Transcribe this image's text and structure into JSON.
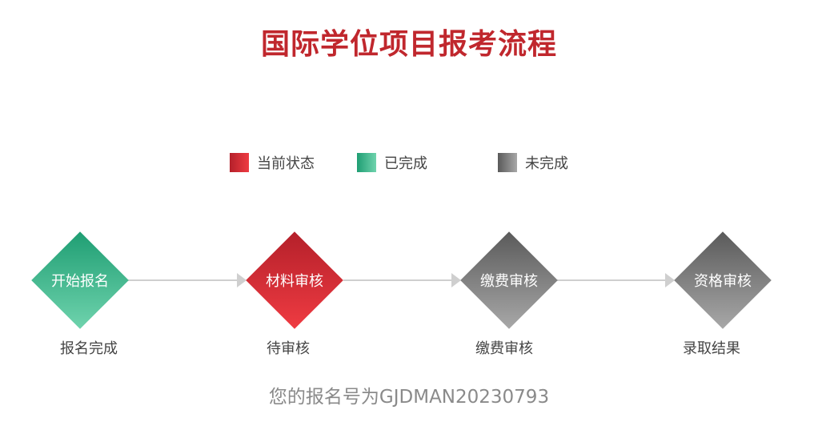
{
  "page": {
    "title": "国际学位项目报考流程"
  },
  "legend": [
    {
      "label": "当前状态",
      "color": "#d9272e"
    },
    {
      "label": "已完成",
      "color": "#2fb383"
    },
    {
      "label": "未完成",
      "color": "#7a7a7a"
    }
  ],
  "steps": [
    {
      "label": "开始报名",
      "status_text": "报名完成",
      "state": "completed"
    },
    {
      "label": "材料审核",
      "status_text": "待审核",
      "state": "current"
    },
    {
      "label": "缴费审核",
      "status_text": "缴费审核",
      "state": "incomplete"
    },
    {
      "label": "资格审核",
      "status_text": "录取结果",
      "state": "incomplete"
    }
  ],
  "registration": {
    "message": "您的报名号为GJDMAN20230793"
  }
}
